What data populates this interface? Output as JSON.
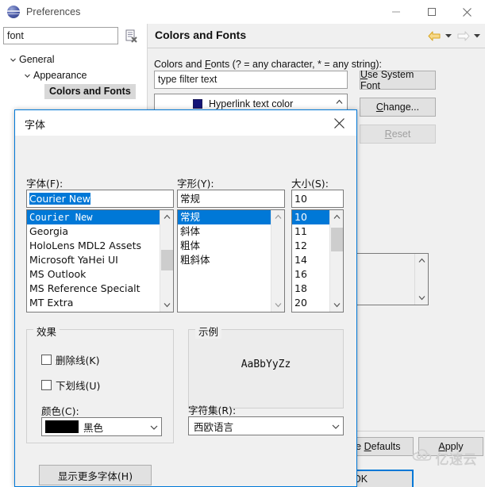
{
  "window": {
    "title": "Preferences",
    "icon": "preferences-globe-icon",
    "minimize": "–",
    "maximize": "☐",
    "close": "×"
  },
  "sidebar": {
    "filter": {
      "value": "font",
      "placeholder": "type filter text"
    },
    "clear_icon": "clear-filter-icon",
    "items": [
      {
        "label": "General",
        "expanded": true,
        "level": 0,
        "selected": false
      },
      {
        "label": "Appearance",
        "expanded": true,
        "level": 1,
        "selected": false
      },
      {
        "label": "Colors and Fonts",
        "expanded": false,
        "level": 2,
        "selected": true
      }
    ]
  },
  "content": {
    "title": "Colors and Fonts",
    "nav": {
      "back": "back-arrow-icon",
      "back_menu": "back-dropdown-icon",
      "forward": "forward-arrow-icon",
      "forward_menu": "forward-dropdown-icon"
    },
    "pane_label": "Colors and Fonts (? = any character, * = any string):",
    "pane_label_parts": {
      "pre": "Colors and ",
      "accel": "F",
      "post": "onts (? = any character, * = any string):"
    },
    "filter": {
      "value": "",
      "placeholder": "type filter text"
    },
    "tree_rows": [
      {
        "label": "Hyperlink text color",
        "swatch": "#141478"
      }
    ],
    "buttons": [
      {
        "id": "use-system-font",
        "pre": "",
        "accel": "U",
        "post": "se System Font",
        "label": "Use System Font",
        "disabled": false
      },
      {
        "id": "change",
        "pre": "",
        "accel": "C",
        "post": "hange...",
        "label": "Change...",
        "disabled": false
      },
      {
        "id": "reset",
        "pre": "",
        "accel": "R",
        "post": "eset",
        "label": "Reset",
        "disabled": true
      }
    ],
    "footer_buttons": [
      {
        "id": "restore-defaults",
        "label": "re Defaults",
        "accel": "D",
        "pre": "re ",
        "post": "efaults"
      },
      {
        "id": "apply",
        "label": "Apply",
        "accel": "A",
        "pre": "",
        "post": "pply"
      },
      {
        "id": "ok",
        "label": "OK",
        "accel": "",
        "pre": "OK",
        "post": ""
      }
    ]
  },
  "dialog": {
    "title": "字体",
    "close_icon": "close-icon",
    "font_label": "字体(F):",
    "font_value": "Courier New",
    "font_list": [
      {
        "name": "Courier New",
        "selected": true,
        "mono": true
      },
      {
        "name": "Georgia",
        "selected": false,
        "mono": false
      },
      {
        "name": "HoloLens MDL2 Assets",
        "selected": false,
        "mono": false
      },
      {
        "name": "Microsoft YaHei UI",
        "selected": false,
        "mono": false
      },
      {
        "name": "MS Outlook",
        "selected": false,
        "mono": false
      },
      {
        "name": "MS Reference Specialt",
        "selected": false,
        "mono": false
      },
      {
        "name": "MT Extra",
        "selected": false,
        "mono": false
      }
    ],
    "style_label": "字形(Y):",
    "style_value": "常规",
    "style_list": [
      {
        "name": "常规",
        "selected": true
      },
      {
        "name": "斜体",
        "selected": false
      },
      {
        "name": "粗体",
        "selected": false
      },
      {
        "name": "粗斜体",
        "selected": false
      }
    ],
    "size_label": "大小(S):",
    "size_value": "10",
    "size_list": [
      {
        "name": "10",
        "selected": true
      },
      {
        "name": "11",
        "selected": false
      },
      {
        "name": "12",
        "selected": false
      },
      {
        "name": "14",
        "selected": false
      },
      {
        "name": "16",
        "selected": false
      },
      {
        "name": "18",
        "selected": false
      },
      {
        "name": "20",
        "selected": false
      }
    ],
    "effects_title": "效果",
    "strikeout_label": "删除线(K)",
    "strikeout_checked": false,
    "underline_label": "下划线(U)",
    "underline_checked": false,
    "color_label": "颜色(C):",
    "color_value": "黑色",
    "color_hex": "#000000",
    "sample_title": "示例",
    "sample_text": "AaBbYyZz",
    "script_label": "字符集(R):",
    "script_value": "西欧语言",
    "more_fonts_label": "显示更多字体(H)"
  },
  "watermark": {
    "text": "亿速云",
    "icon": "cloud-logo-icon"
  },
  "colors": {
    "accent": "#0078d7",
    "chrome": "#f0f0f0",
    "selection": "#d8d8d8"
  }
}
